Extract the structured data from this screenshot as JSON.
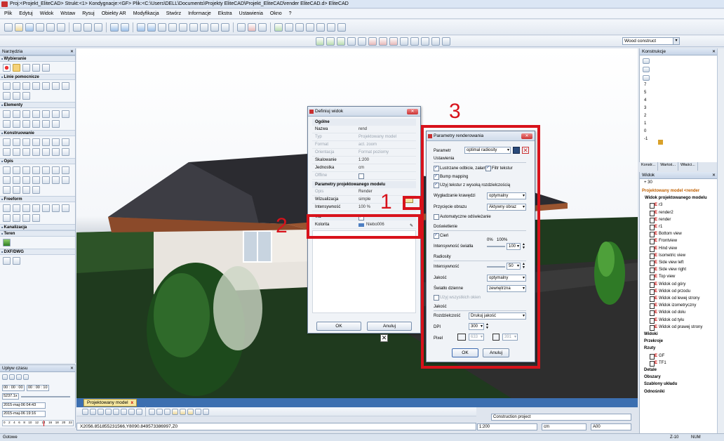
{
  "window": {
    "title": "Proj:<Projekt_EliteCAD> Strukt:<1>   Kondygnacje:<GF>   Plik:<C:\\Users\\DELL\\Documents\\Projekty EliteCAD\\Projekt_EliteCAD\\render EliteCAD.d> EliteCAD"
  },
  "menu": [
    "Plik",
    "Edytuj",
    "Widok",
    "Wstaw",
    "Rysuj",
    "Obiekty AR",
    "Modyfikacja",
    "Stwórz",
    "Informacje",
    "Ekstra",
    "Ustawienia",
    "Okno",
    "?"
  ],
  "toolbar": {
    "wood_select": "Wood construct"
  },
  "left_panel": {
    "title": "Narzędzia",
    "sections": [
      "Wybieranie",
      "Linie pomocnicze",
      "Elementy",
      "Konstruowanie",
      "Opis",
      "Freeform",
      "Kanalizacja",
      "Teren",
      "DXF/DWG"
    ]
  },
  "time_panel": {
    "title": "Upływ czasu",
    "time_start": "00 : 00 : 00",
    "time_end": "00 : 00 : 10",
    "value": "5237.1x",
    "date_from": "2015-maj-06 04:43",
    "date_to": "2015-maj-06 19:16",
    "scale": [
      "0",
      "2",
      "4",
      "6",
      "8",
      "10",
      "12",
      "14",
      "16",
      "18",
      "20",
      "22"
    ]
  },
  "view_tab": {
    "label": "Projektowany model",
    "close": "x"
  },
  "coords": "X2056.851855231566,Y8090.849573386997,Z0",
  "bottom_fields": {
    "project": "Construction project",
    "scale": "1:200",
    "unit": "cm",
    "layer": "A00"
  },
  "status": {
    "left": "Gotowe",
    "z": "Z-10",
    "num": "NUM"
  },
  "konstrukcje": {
    "title": "Konstrukcje",
    "rows": [
      "7",
      "5",
      "4",
      "3",
      "2",
      "1",
      "0",
      "-1"
    ]
  },
  "right_tabs": [
    "Konstr...",
    "Wartoś...",
    "Właści..."
  ],
  "widok": {
    "title": "Widok",
    "counter": "+ 30",
    "root": "Projektowany model <render",
    "group1": "Widok projektowanego modelu",
    "views": [
      "r3",
      "render2",
      "render",
      "r1",
      "Bottom view",
      "Frontview",
      "Hind view",
      "Isometric view",
      "Side view left",
      "Side view right",
      "Top view",
      "Widok od góry",
      "Widok od przodu",
      "Widok od lewej strony",
      "Widok izometryczny",
      "Widok od dołu",
      "Widok od tyłu",
      "Widok od prawej strony"
    ],
    "groups": [
      "Widoki",
      "Przekroje",
      "Rzuty"
    ],
    "rzuty": [
      "GF",
      "TF1"
    ],
    "groups2": [
      "Detale",
      "Obszary",
      "Szablony układu",
      "Odnośniki"
    ]
  },
  "dlg_widok": {
    "title": "Definiuj widok",
    "cat_general": "Ogólne",
    "rows": [
      {
        "k": "Nazwa",
        "v": "rend"
      },
      {
        "k": "Typ",
        "v": "Projektowany model"
      },
      {
        "k": "Format",
        "v": "act. zoom"
      },
      {
        "k": "Orientacja",
        "v": "Format poziomy"
      },
      {
        "k": "Skalowanie",
        "v": "1:200"
      },
      {
        "k": "Jednostka",
        "v": "cm"
      },
      {
        "k": "Offline",
        "v": ""
      }
    ],
    "cat_params": "Parametry projektowanego modelu",
    "opis_k": "Opis",
    "opis_v": "Render",
    "wiz_k": "Wizualizacja",
    "wiz_v": "simple",
    "int_k": "Intensywność",
    "int_v": "100 %",
    "tlo_k": "Tło",
    "kolor_k": "Kolorita",
    "kolor_v": "Niebo006",
    "ok": "OK",
    "cancel": "Anuluj"
  },
  "dlg_render": {
    "title": "Parametry renderowania",
    "param_label": "Parametr",
    "param_value": "optimal radiosity",
    "sec_ustawienia": "Ustawienia",
    "cb_lustrzane": "Lustrzane odbicie, załam",
    "cb_filtr": "Filtr tekstur",
    "cb_bump": "Bump mapping",
    "cb_tekstur": "Użyj tekstur z wysoką rozdzielczością",
    "wygladzanie_label": "Wygładzanie krawędzi",
    "wygladzanie_value": "optymalny",
    "przyciecie_label": "Przycięcie obrazu",
    "przyciecie_value": "Aktywny obraz",
    "cb_auto": "Automatyczne odświeżanie",
    "sec_oswietlenie": "Doświetlenie",
    "cb_cien": "Cień",
    "pct0": "0%",
    "pct100": "100%",
    "intensywnosc_label": "Intensywność światła",
    "intensywnosc_value": "100",
    "sec_radiosity": "Radiosity",
    "rad_int_label": "Intensywność",
    "rad_int_value": "50",
    "jakosc_label": "Jakość",
    "jakosc_value": "optymalny",
    "swiatlo_label": "Światło dzienne",
    "swiatlo_value": "zewnętrzna",
    "cb_wszystkich": "Użyj wszystkich okien",
    "sec_jakosc": "Jakość",
    "rozdz_label": "Rozdzielczość",
    "rozdz_value": "Drukuj jakość",
    "dpi_label": "DPI",
    "dpi_value": "300",
    "pixel_label": "Pixel",
    "pixel_w": "633",
    "pixel_h": "391",
    "ok": "OK",
    "cancel": "Anuluj"
  },
  "annotations": {
    "n1": "1",
    "n2": "2",
    "n3": "3"
  }
}
